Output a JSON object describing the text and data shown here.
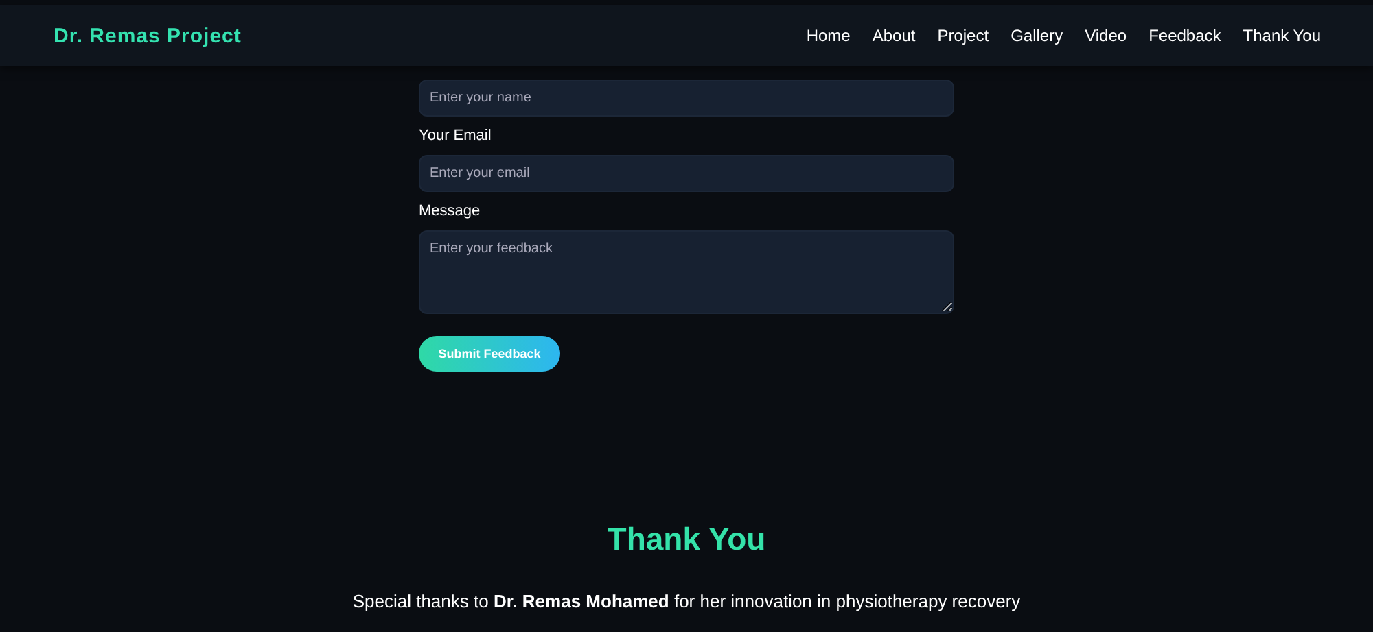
{
  "header": {
    "brand": "Dr. Remas Project",
    "nav": [
      "Home",
      "About",
      "Project",
      "Gallery",
      "Video",
      "Feedback",
      "Thank You"
    ]
  },
  "form": {
    "fields": [
      {
        "kind": "input",
        "placeholder": "Enter your name"
      },
      {
        "kind": "input",
        "label": "Your Email",
        "placeholder": "Enter your email"
      },
      {
        "kind": "textarea",
        "label": "Message",
        "placeholder": "Enter your feedback"
      }
    ],
    "submit": "Submit Feedback"
  },
  "thanks": {
    "title": "Thank You",
    "text": "Special thanks to **Dr. Remas Mohamed** for her innovation in physiotherapy recovery"
  }
}
